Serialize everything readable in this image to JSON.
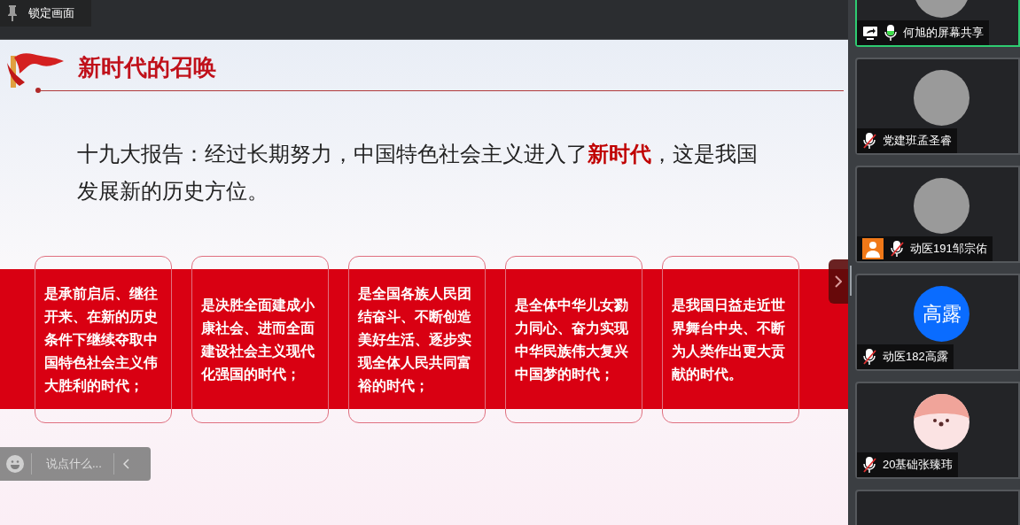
{
  "toolbar": {
    "pin_label": "锁定画面"
  },
  "slide": {
    "title": "新时代的召唤",
    "statement": "十九大报告：经过长期努力，中国特色社会主义进入了**新时代**，这是我国发展新的历史方位。",
    "cards": [
      "是承前启后、继往开来、在新的历史条件下继续夺取中国特色社会主义伟大胜利的时代；",
      "是决胜全面建成小康社会、进而全面建设社会主义现代化强国的时代；",
      "是全国各族人民团结奋斗、不断创造美好生活、逐步实现全体人民共同富裕的时代；",
      "是全体中华儿女勠力同心、奋力实现中华民族伟大复兴中国梦的时代；",
      "是我国日益走近世界舞台中央、不断为人类作出更大贡献的时代。"
    ]
  },
  "chat": {
    "placeholder": "说点什么..."
  },
  "participants": [
    {
      "name": "何旭的屏幕共享",
      "kind": "photo",
      "sharing": true,
      "muted": false,
      "highlighted": true,
      "person_badge": false
    },
    {
      "name": "党建班孟圣睿",
      "kind": "photo",
      "sharing": false,
      "muted": true,
      "highlighted": false,
      "person_badge": false
    },
    {
      "name": "动医191邹宗佑",
      "kind": "photo",
      "sharing": false,
      "muted": true,
      "highlighted": false,
      "person_badge": true
    },
    {
      "name": "动医182高露",
      "kind": "initials",
      "initials": "高露",
      "sharing": false,
      "muted": true,
      "highlighted": false,
      "person_badge": false
    },
    {
      "name": "20基础张臻玮",
      "kind": "cartoon",
      "sharing": false,
      "muted": true,
      "highlighted": false,
      "person_badge": false
    }
  ]
}
